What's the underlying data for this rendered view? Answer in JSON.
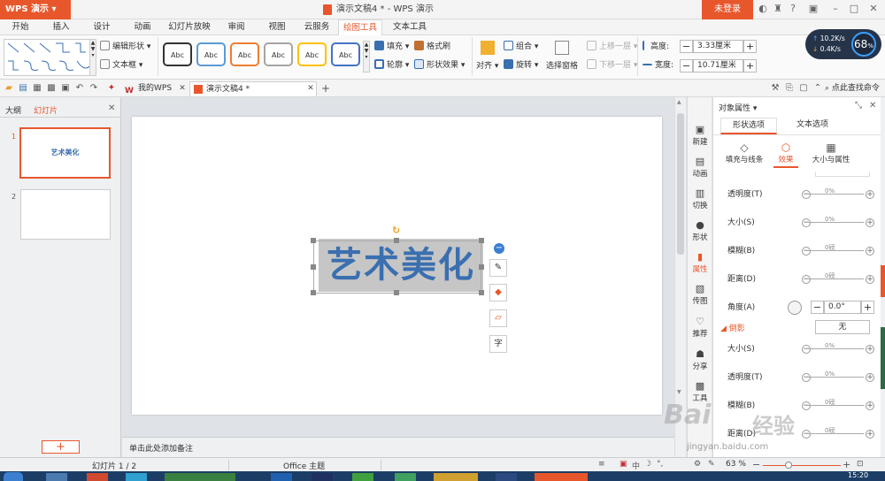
{
  "titlebar": {
    "app_button": "WPS 演示",
    "doc_title": "演示文稿4 * - WPS 演示",
    "login": "未登录"
  },
  "menu": {
    "tabs": [
      "开始",
      "插入",
      "设计",
      "动画",
      "幻灯片放映",
      "审阅",
      "视图",
      "云服务",
      "绘图工具",
      "文本工具"
    ],
    "active": "绘图工具"
  },
  "ribbon": {
    "edit_shape": "编辑形状",
    "text_box": "文本框",
    "style_label": "Abc",
    "fill": "填充",
    "format_painter": "格式刷",
    "outline": "轮廓",
    "shape_effects": "形状效果",
    "align": "对齐",
    "group": "组合",
    "rotate": "旋转",
    "selection_pane": "选择窗格",
    "bring_forward": "上移一层",
    "send_backward": "下移一层",
    "height_label": "高度:",
    "height_value": "3.33厘米",
    "width_label": "宽度:",
    "width_value": "10.71厘米"
  },
  "network": {
    "up": "10.2K/s",
    "down": "0.4K/s",
    "percent": "68"
  },
  "quickbar": {
    "tab1": "我的WPS",
    "tab2": "演示文稿4 *",
    "find_cmd": "点此查找命令"
  },
  "leftpanel": {
    "tab_outline": "大纲",
    "tab_slides": "幻灯片",
    "slide1_num": "1",
    "slide1_text": "艺术美化",
    "slide2_num": "2"
  },
  "slide": {
    "text": "艺术美化"
  },
  "notes_placeholder": "单击此处添加备注",
  "sidebar": {
    "items": [
      "新建",
      "动画",
      "切换",
      "形状",
      "属性",
      "传图",
      "推荐",
      "分享",
      "工具"
    ]
  },
  "props": {
    "title": "对象属性",
    "tab_shape": "形状选项",
    "tab_text": "文本选项",
    "sub_fill": "填充与线条",
    "sub_effect": "效果",
    "sub_size": "大小与属性",
    "rows": [
      {
        "label": "透明度(T)",
        "value": "0%"
      },
      {
        "label": "大小(S)",
        "value": "0%"
      },
      {
        "label": "模糊(B)",
        "value": "0磅"
      },
      {
        "label": "距离(D)",
        "value": "0磅"
      }
    ],
    "angle_label": "角度(A)",
    "angle_value": "0.0°",
    "shadow_section": "倒影",
    "shadow_value": "无",
    "rows2": [
      {
        "label": "大小(S)",
        "value": "0%"
      },
      {
        "label": "透明度(T)",
        "value": "0%"
      },
      {
        "label": "模糊(B)",
        "value": "0磅"
      },
      {
        "label": "距离(D)",
        "value": "0磅"
      }
    ]
  },
  "status": {
    "slide_count": "幻灯片 1 / 2",
    "theme": "Office 主题",
    "zoom": "63 %"
  },
  "watermark": {
    "line1": "Bai",
    "line2": "经验",
    "url": "jingyan.baidu.com"
  },
  "clock": "15:20"
}
